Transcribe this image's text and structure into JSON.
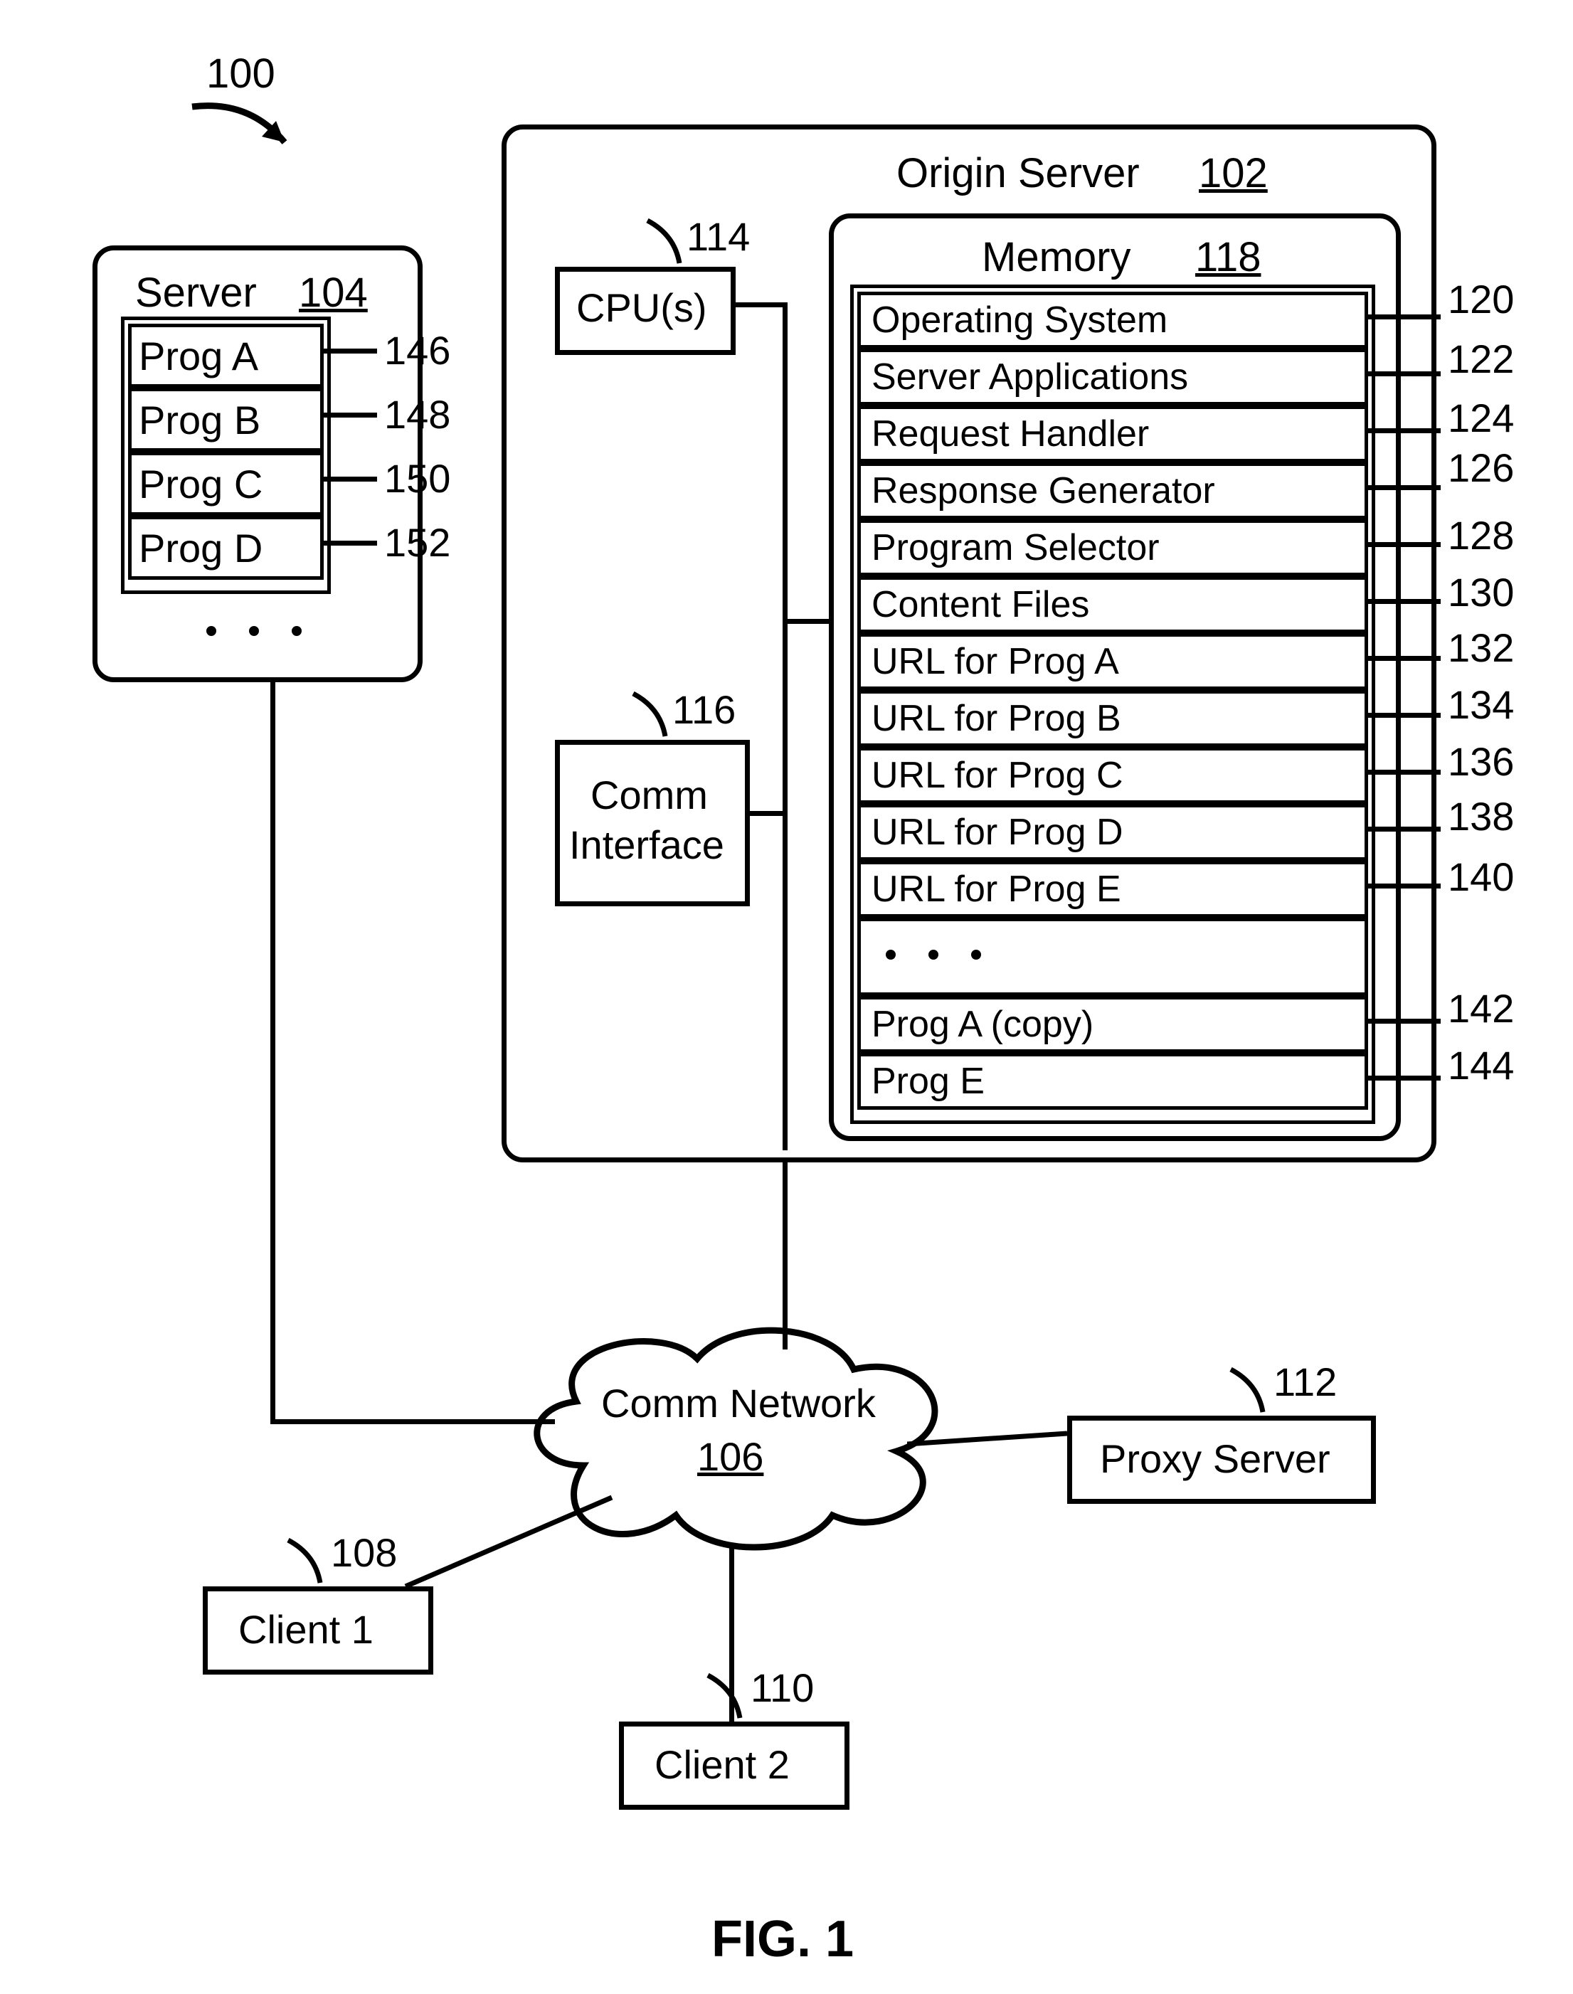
{
  "figure": {
    "caption": "FIG. 1",
    "ref100": "100"
  },
  "origin_server": {
    "title": "Origin Server",
    "ref": "102",
    "cpu": {
      "label": "CPU(s)",
      "ref": "114"
    },
    "comm": {
      "label1": "Comm",
      "label2": "Interface",
      "ref": "116"
    },
    "memory": {
      "title": "Memory",
      "ref": "118",
      "items": [
        {
          "text": "Operating System",
          "ref": "120"
        },
        {
          "text": "Server Applications",
          "ref": "122"
        },
        {
          "text": "Request Handler",
          "ref": "124"
        },
        {
          "text": "Response Generator",
          "ref": "126"
        },
        {
          "text": "Program Selector",
          "ref": "128"
        },
        {
          "text": "Content Files",
          "ref": "130"
        },
        {
          "text": "URL for Prog A",
          "ref": "132"
        },
        {
          "text": "URL for Prog B",
          "ref": "134"
        },
        {
          "text": "URL for Prog C",
          "ref": "136"
        },
        {
          "text": "URL for Prog D",
          "ref": "138"
        },
        {
          "text": "URL for Prog E",
          "ref": "140"
        }
      ],
      "ellipsis_row": " ",
      "items2": [
        {
          "text": "Prog A (copy)",
          "ref": "142"
        },
        {
          "text": "Prog E",
          "ref": "144"
        }
      ]
    }
  },
  "server104": {
    "title": "Server",
    "ref": "104",
    "items": [
      {
        "text": "Prog A",
        "ref": "146"
      },
      {
        "text": "Prog B",
        "ref": "148"
      },
      {
        "text": "Prog C",
        "ref": "150"
      },
      {
        "text": "Prog D",
        "ref": "152"
      }
    ]
  },
  "network": {
    "label": "Comm Network",
    "ref": "106"
  },
  "client1": {
    "label": "Client 1",
    "ref": "108"
  },
  "client2": {
    "label": "Client 2",
    "ref": "110"
  },
  "proxy": {
    "label": "Proxy Server",
    "ref": "112"
  }
}
